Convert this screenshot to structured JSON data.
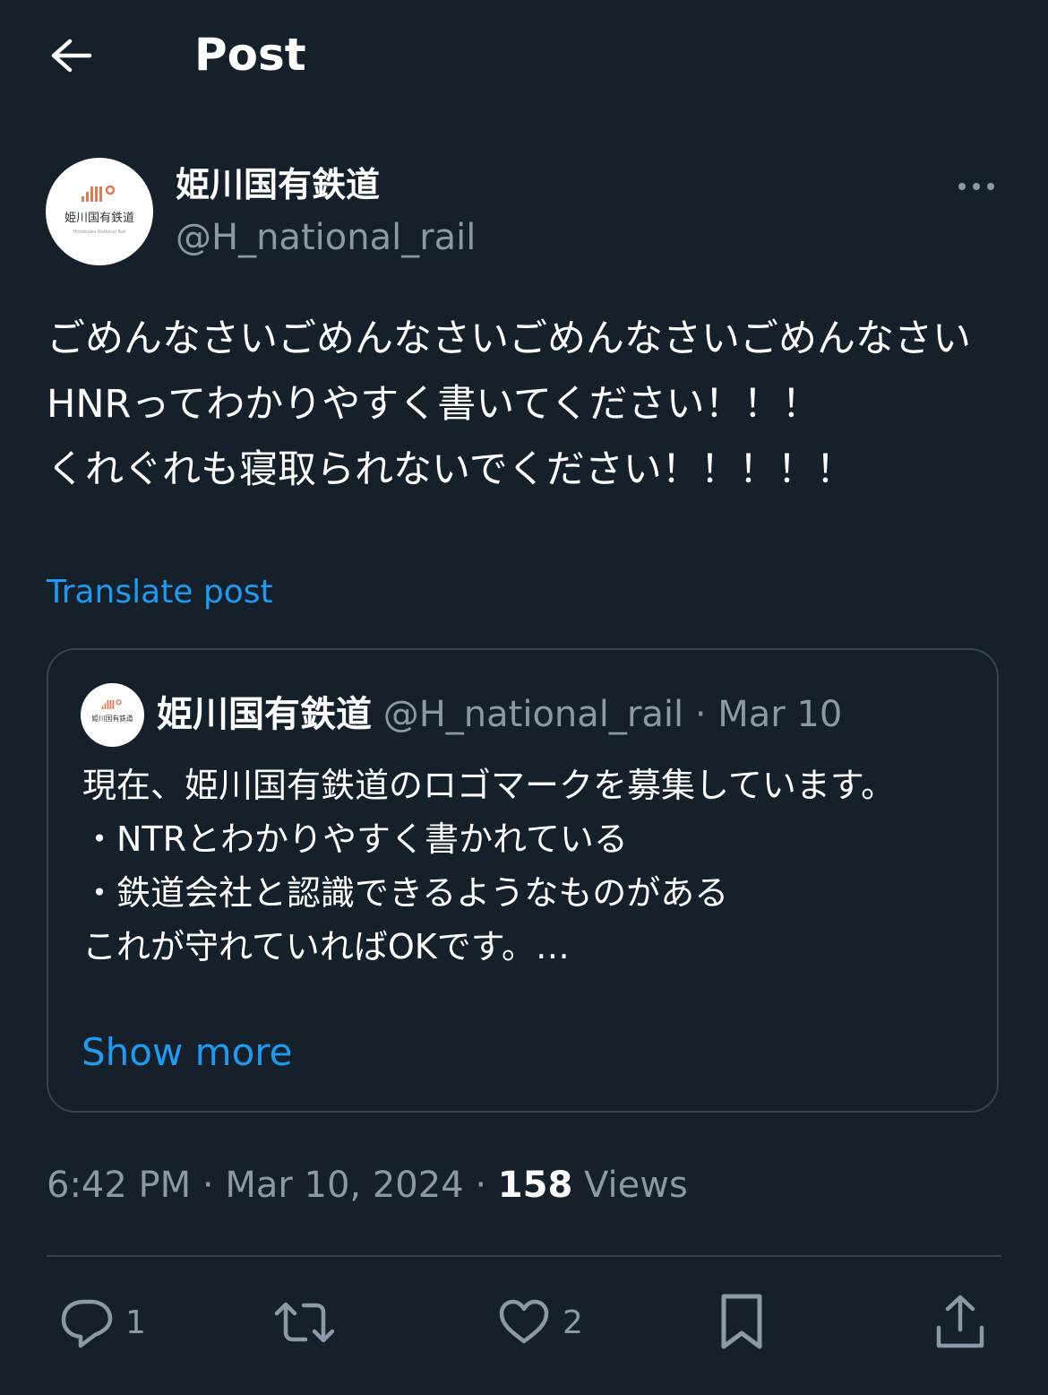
{
  "header": {
    "title": "Post",
    "back_icon": "arrow-left-icon"
  },
  "author": {
    "display_name": "姫川国有鉄道",
    "handle": "@H_national_rail",
    "avatar_logo_text": "姫川国有鉄道",
    "avatar_sub_text": "Himekawa National Rail"
  },
  "post": {
    "text": "ごめんなさいごめんなさいごめんなさいごめんなさい\nHNRってわかりやすく書いてください！！！\nくれぐれも寝取られないでください！！！！！",
    "translate_label": "Translate post"
  },
  "quote": {
    "display_name": "姫川国有鉄道",
    "handle": "@H_national_rail",
    "separator": "·",
    "date": "Mar 10",
    "text": "現在、姫川国有鉄道のロゴマークを募集しています。\n・NTRとわかりやすく書かれている\n・鉄道会社と認識できるようなものがある\nこれが守れていればOKです。…",
    "show_more_label": "Show more"
  },
  "meta": {
    "time": "6:42 PM",
    "separator": "·",
    "date": "Mar 10, 2024",
    "views_count": "158",
    "views_label": "Views"
  },
  "actions": {
    "reply_count": "1",
    "like_count": "2"
  },
  "colors": {
    "background": "#15202b",
    "accent": "#1d9bf0",
    "secondary_text": "#8b98a5",
    "border": "#38444d",
    "logo_orange": "#e07a52"
  }
}
